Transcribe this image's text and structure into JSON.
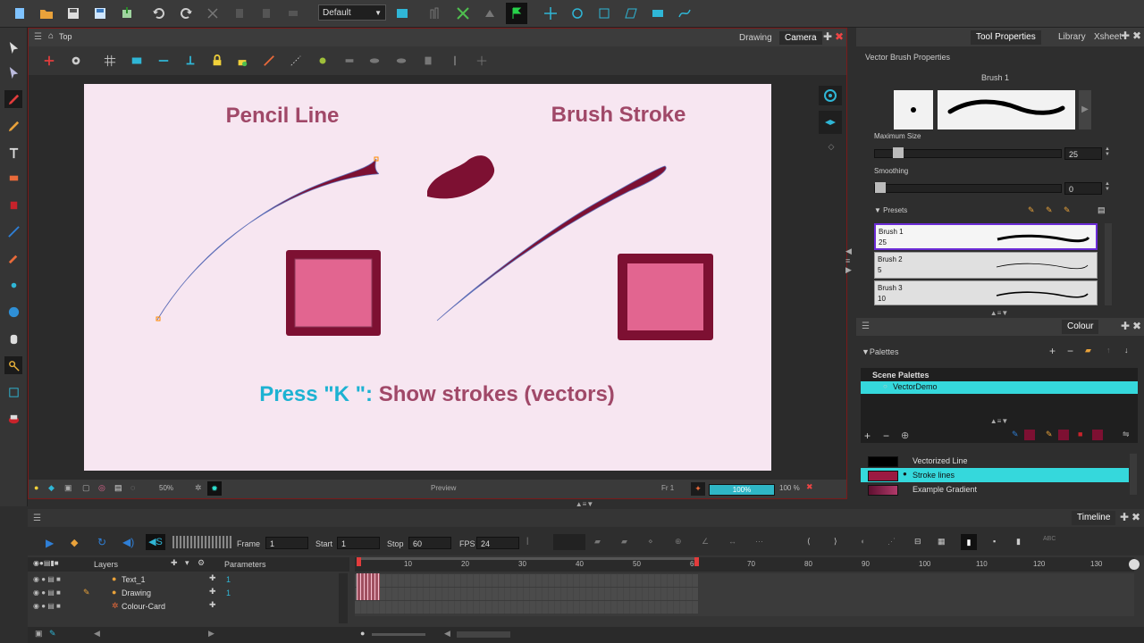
{
  "toolbar": {
    "workspace": "Default"
  },
  "viewer": {
    "breadcrumb": "Top",
    "tabs": [
      "Drawing",
      "Camera"
    ],
    "zoom": "50%",
    "preview_label": "Preview",
    "frame_label": "Fr 1",
    "progress_value": 1.0,
    "progress_text": "100%",
    "zoom_right": "100 %"
  },
  "stage": {
    "pencil_title": "Pencil Line",
    "brush_title": "Brush Stroke",
    "caption_key": "Press \"K \":",
    "caption_rest": " Show strokes (vectors)",
    "colors": {
      "background": "#f7e6f1",
      "stroke": "#7d1032",
      "fill": "#e26590",
      "title": "#a04868",
      "caption_key": "#1db2d2"
    }
  },
  "tool_props": {
    "tabs": [
      "Tool Properties",
      "Library",
      "Xsheet"
    ],
    "section": "Vector Brush Properties",
    "brush_name": "Brush 1",
    "max_size_label": "Maximum Size",
    "max_size": "25",
    "max_size_level": 0.1,
    "smoothing_label": "Smoothing",
    "smoothing": "0",
    "smoothing_level": 0.0,
    "presets_label": "Presets",
    "presets": [
      {
        "name": "Brush 1",
        "size": "25"
      },
      {
        "name": "Brush 2",
        "size": "5"
      },
      {
        "name": "Brush 3",
        "size": "10"
      }
    ]
  },
  "colour": {
    "title": "Colour",
    "palettes_label": "Palettes",
    "scene_palettes_label": "Scene Palettes",
    "palette": "VectorDemo",
    "swatches": [
      {
        "name": "Vectorized Line",
        "color": "#000000"
      },
      {
        "name": "Stroke lines",
        "color": "#9b1a42"
      },
      {
        "name": "Example Gradient",
        "color": "#9b2a5a"
      }
    ]
  },
  "timeline": {
    "title": "Timeline",
    "frame_label": "Frame",
    "frame": "1",
    "start_label": "Start",
    "start": "1",
    "stop_label": "Stop",
    "stop": "60",
    "fps_label": "FPS",
    "fps": "24",
    "layers_label": "Layers",
    "parameters_label": "Parameters",
    "layers": [
      {
        "name": "Text_1",
        "param": "1"
      },
      {
        "name": "Drawing",
        "param": "1"
      },
      {
        "name": "Colour-Card",
        "param": ""
      }
    ],
    "ruler": [
      "10",
      "20",
      "30",
      "40",
      "50",
      "60",
      "70",
      "80",
      "90",
      "100",
      "110",
      "120",
      "130"
    ]
  }
}
